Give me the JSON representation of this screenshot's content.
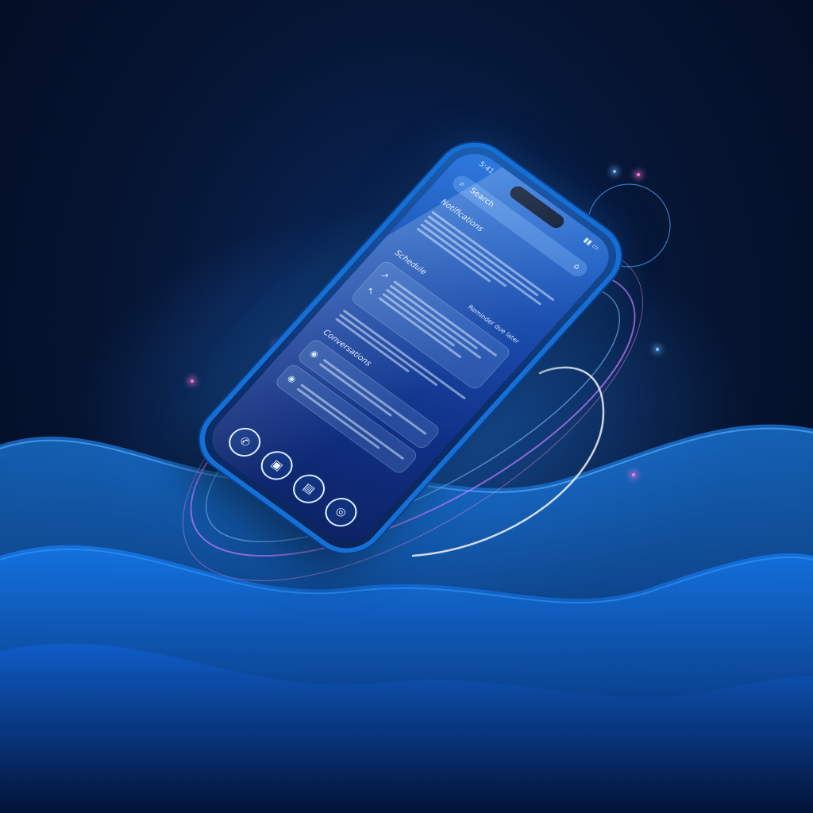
{
  "phone": {
    "status_time": "5:41",
    "status_icons": "▮▮ ▭",
    "search": {
      "label": "Search",
      "icon": "search-icon",
      "mic_icon": "mic-icon"
    },
    "sections": [
      {
        "title": "Notifications"
      },
      {
        "title": "Schedule"
      },
      {
        "title": "Conversations"
      }
    ],
    "right_note": "Reminder due later",
    "dock_icons": [
      {
        "name": "phone-icon",
        "glyph": "✆"
      },
      {
        "name": "messages-icon",
        "glyph": "▣"
      },
      {
        "name": "files-icon",
        "glyph": "▤"
      },
      {
        "name": "camera-icon",
        "glyph": "◎"
      }
    ]
  },
  "colors": {
    "background": "#030b1f",
    "waves": "#0d63d8",
    "glow_pink": "#ff7ad9",
    "glow_blue": "#3aa0ff",
    "phone_frame": "#1570d6"
  }
}
